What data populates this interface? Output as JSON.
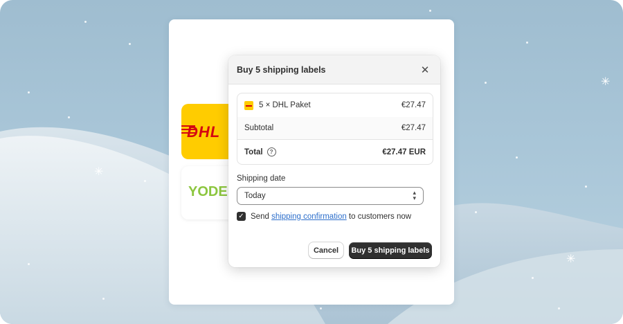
{
  "modal": {
    "title": "Buy 5 shipping labels",
    "close_icon": "close-icon"
  },
  "summary": {
    "item_label": "5 × DHL Paket",
    "item_price": "€27.47",
    "subtotal_label": "Subtotal",
    "subtotal_value": "€27.47",
    "total_label": "Total",
    "total_value": "€27.47 EUR"
  },
  "shipping_date": {
    "label": "Shipping date",
    "selected": "Today"
  },
  "confirmation": {
    "checked": true,
    "text_before": "Send ",
    "link_text": "shipping confirmation",
    "text_after": " to customers now"
  },
  "actions": {
    "cancel_label": "Cancel",
    "buy_label": "Buy 5 shipping labels"
  },
  "carriers": {
    "dhl_logo_text": "DHL",
    "yodel_logo_text": "YODEL"
  },
  "colors": {
    "dhl_yellow": "#ffcc00",
    "dhl_red": "#d40511",
    "yodel_green": "#8cc63f",
    "primary_button": "#303030",
    "link": "#2c6ecb"
  }
}
